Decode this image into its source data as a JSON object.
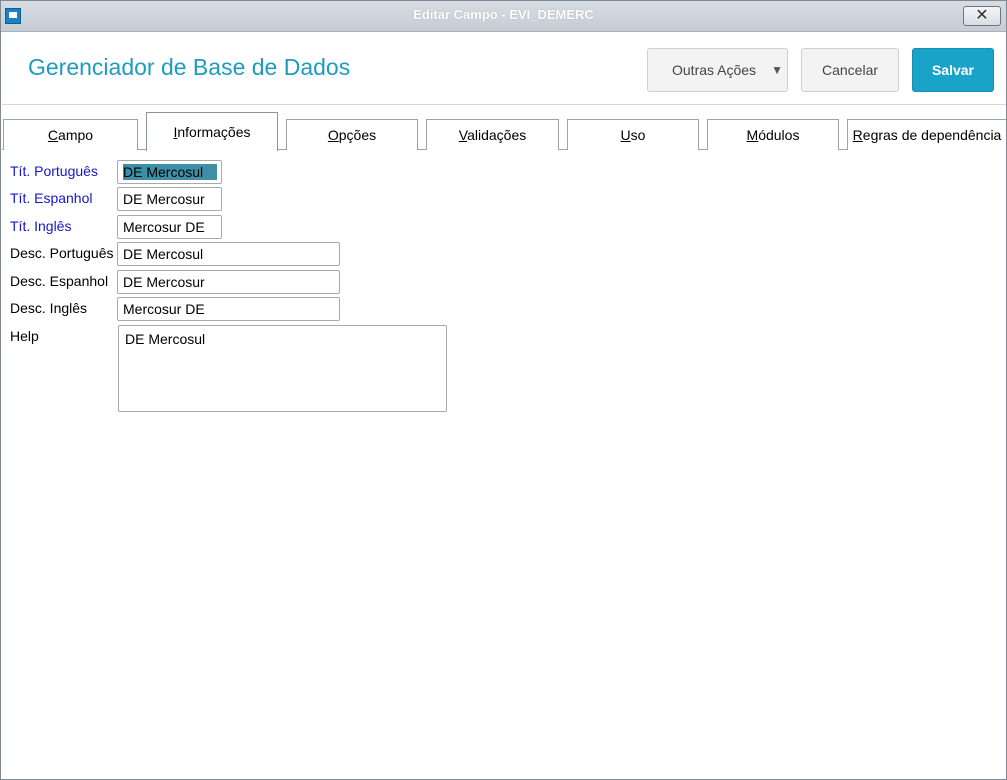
{
  "window": {
    "title": "Editar Campo - EVI_DEMERC"
  },
  "header": {
    "app_title": "Gerenciador de Base de Dados",
    "more_actions_label": "Outras Ações",
    "cancel_label": "Cancelar",
    "save_label": "Salvar"
  },
  "tabs": [
    {
      "label": "Campo",
      "underline": "C",
      "rest": "ampo"
    },
    {
      "label": "Informações",
      "underline": "I",
      "rest": "nformações"
    },
    {
      "label": "Opções",
      "underline": "O",
      "rest": "pções"
    },
    {
      "label": "Validações",
      "underline": "V",
      "rest": "alidações"
    },
    {
      "label": "Uso",
      "underline": "U",
      "rest": "so"
    },
    {
      "label": "Módulos",
      "underline": "M",
      "rest": "ódulos"
    },
    {
      "label": "Regras de dependência",
      "underline": "R",
      "rest": "egras de dependência"
    }
  ],
  "active_tab": "Informações",
  "form": {
    "tit_portugues": {
      "label": "Tít. Português",
      "value": "DE Mercosul"
    },
    "tit_espanhol": {
      "label": "Tít. Espanhol",
      "value": "DE Mercosur"
    },
    "tit_ingles": {
      "label": "Tít. Inglês",
      "value": "Mercosur DE"
    },
    "desc_portugues": {
      "label": "Desc. Português",
      "value": "DE Mercosul"
    },
    "desc_espanhol": {
      "label": "Desc. Espanhol",
      "value": "DE Mercosur"
    },
    "desc_ingles": {
      "label": "Desc. Inglês",
      "value": "Mercosur DE"
    },
    "help": {
      "label": "Help",
      "value": "DE Mercosul"
    }
  },
  "colors": {
    "accent": "#1e9bbf",
    "save_button": "#19a3c9",
    "required_label": "#1717c7",
    "selection": "#3d8fa6"
  },
  "icons": [
    "app-window-icon",
    "close-icon",
    "chevron-down-icon"
  ]
}
